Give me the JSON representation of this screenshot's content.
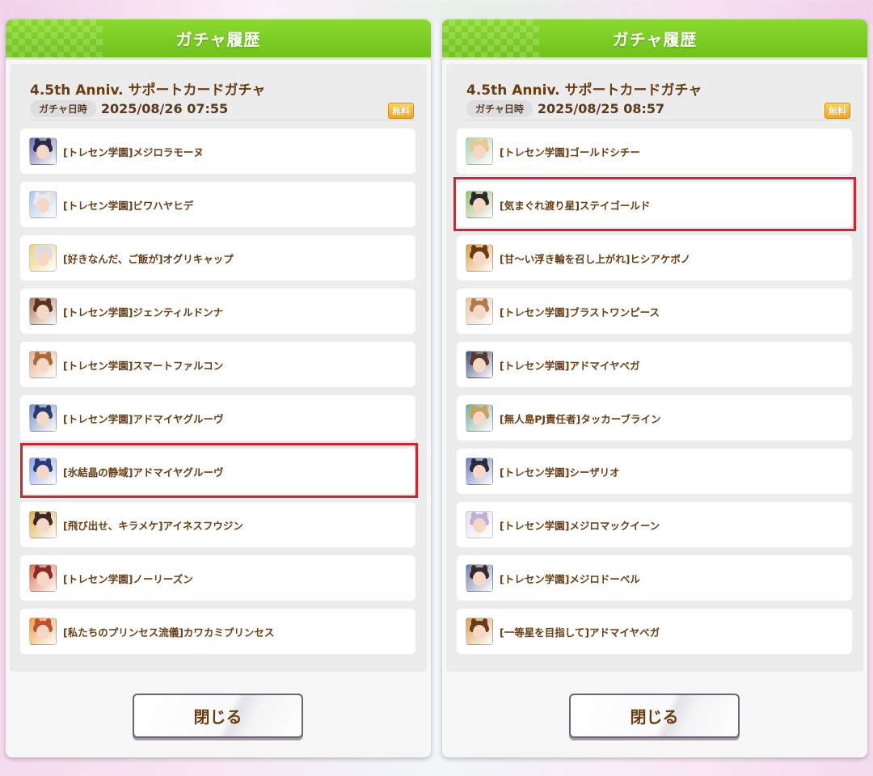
{
  "panels": [
    {
      "title": "ガチャ履歴",
      "gacha_name": "4.5th Anniv. サポートカードガチャ",
      "date_label": "ガチャ日時",
      "date_value": "2025/08/26 07:55",
      "free_badge": "無料",
      "cards": [
        {
          "label": "[トレセン学園]メジロラモーヌ",
          "colors": [
            "#2a2a4a",
            "#6b6fb0"
          ]
        },
        {
          "label": "[トレセン学園]ビワハヤヒデ",
          "colors": [
            "#e8e8ee",
            "#a8c8e8"
          ]
        },
        {
          "label": "[好きなんだ、ご飯が]オグリキャップ",
          "colors": [
            "#dcdce6",
            "#f0d070"
          ]
        },
        {
          "label": "[トレセン学園]ジェンティルドンナ",
          "colors": [
            "#5a3420",
            "#b07a5a"
          ]
        },
        {
          "label": "[トレセン学園]スマートファルコン",
          "colors": [
            "#a86a3a",
            "#e8b090"
          ]
        },
        {
          "label": "[トレセン学園]アドマイヤグルーヴ",
          "colors": [
            "#2a3a6a",
            "#7090c0"
          ]
        },
        {
          "label": "[氷結晶の静域]アドマイヤグルーヴ",
          "colors": [
            "#2a3a7a",
            "#8aa8e8"
          ]
        },
        {
          "label": "[飛び出せ、キラメケ]アイネスフウジン",
          "colors": [
            "#3a2a2a",
            "#e0b040"
          ]
        },
        {
          "label": "[トレセン学園]ノーリーズン",
          "colors": [
            "#8a2a2a",
            "#e07050"
          ]
        },
        {
          "label": "[私たちのプリンセス流儀]カワカミプリンセス",
          "colors": [
            "#c05030",
            "#f0a040"
          ]
        }
      ],
      "close_label": "閉じる"
    },
    {
      "title": "ガチャ履歴",
      "gacha_name": "4.5th Anniv. サポートカードガチャ",
      "date_label": "ガチャ日時",
      "date_value": "2025/08/25 08:57",
      "free_badge": "無料",
      "cards": [
        {
          "label": "[トレセン学園]ゴールドシチー",
          "colors": [
            "#e8c890",
            "#a8d8b0"
          ]
        },
        {
          "label": "[気まぐれ渡り星]ステイゴールド",
          "colors": [
            "#2a2a2a",
            "#9ac070"
          ]
        },
        {
          "label": "[甘～い浮き輪を召し上がれ]ヒシアケボノ",
          "colors": [
            "#6a3a1a",
            "#e0a040"
          ]
        },
        {
          "label": "[トレセン学園]ブラストワンピース",
          "colors": [
            "#b07a4a",
            "#e8c8a0"
          ]
        },
        {
          "label": "[トレセン学園]アドマイヤベガ",
          "colors": [
            "#5a3a2a",
            "#405080"
          ]
        },
        {
          "label": "[無人島PJ責任者]タッカーブライン",
          "colors": [
            "#c8a060",
            "#70b0a0"
          ]
        },
        {
          "label": "[トレセン学園]シーザリオ",
          "colors": [
            "#2a2a3a",
            "#6a80c0"
          ]
        },
        {
          "label": "[トレセン学園]メジロマックイーン",
          "colors": [
            "#c0b0d8",
            "#e8e0f0"
          ]
        },
        {
          "label": "[トレセン学園]メジロドーベル",
          "colors": [
            "#3a2a2a",
            "#7080b0"
          ]
        },
        {
          "label": "[一等星を目指して]アドマイヤベガ",
          "colors": [
            "#6a3a1a",
            "#e0a050"
          ]
        }
      ],
      "close_label": "閉じる"
    }
  ],
  "highlight_color": "#d8232f",
  "accent_green": "#7cc82a",
  "text_brown": "#6b3d12"
}
